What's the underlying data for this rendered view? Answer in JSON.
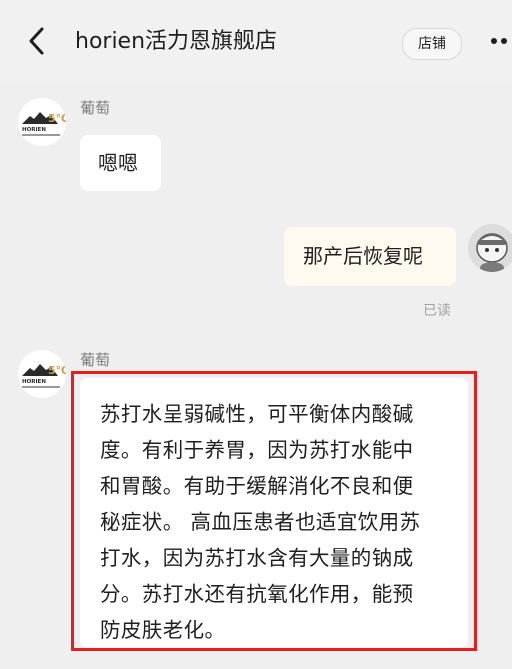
{
  "header": {
    "title": "horien活力恩旗舰店",
    "shop_button": "店铺"
  },
  "brand": {
    "logo_name": "HORIEN",
    "logo_number": "5℃"
  },
  "colors": {
    "highlight": "#e51e1e",
    "my_bubble": "#fffaf0"
  },
  "messages": [
    {
      "sender": "葡萄",
      "text": "嗯嗯"
    },
    {
      "sender": "me",
      "text": "那产后恢复呢",
      "status": "已读"
    },
    {
      "sender": "葡萄",
      "text": "苏打水呈弱碱性，可平衡体内酸碱\n度。有利于养胃，因为苏打水能中\n和胃酸。有助于缓解消化不良和便\n秘症状。 高血压患者也适宜饮用苏\n打水，因为苏打水含有大量的钠成\n分。苏打水还有抗氧化作用，能预\n防皮肤老化。"
    }
  ]
}
